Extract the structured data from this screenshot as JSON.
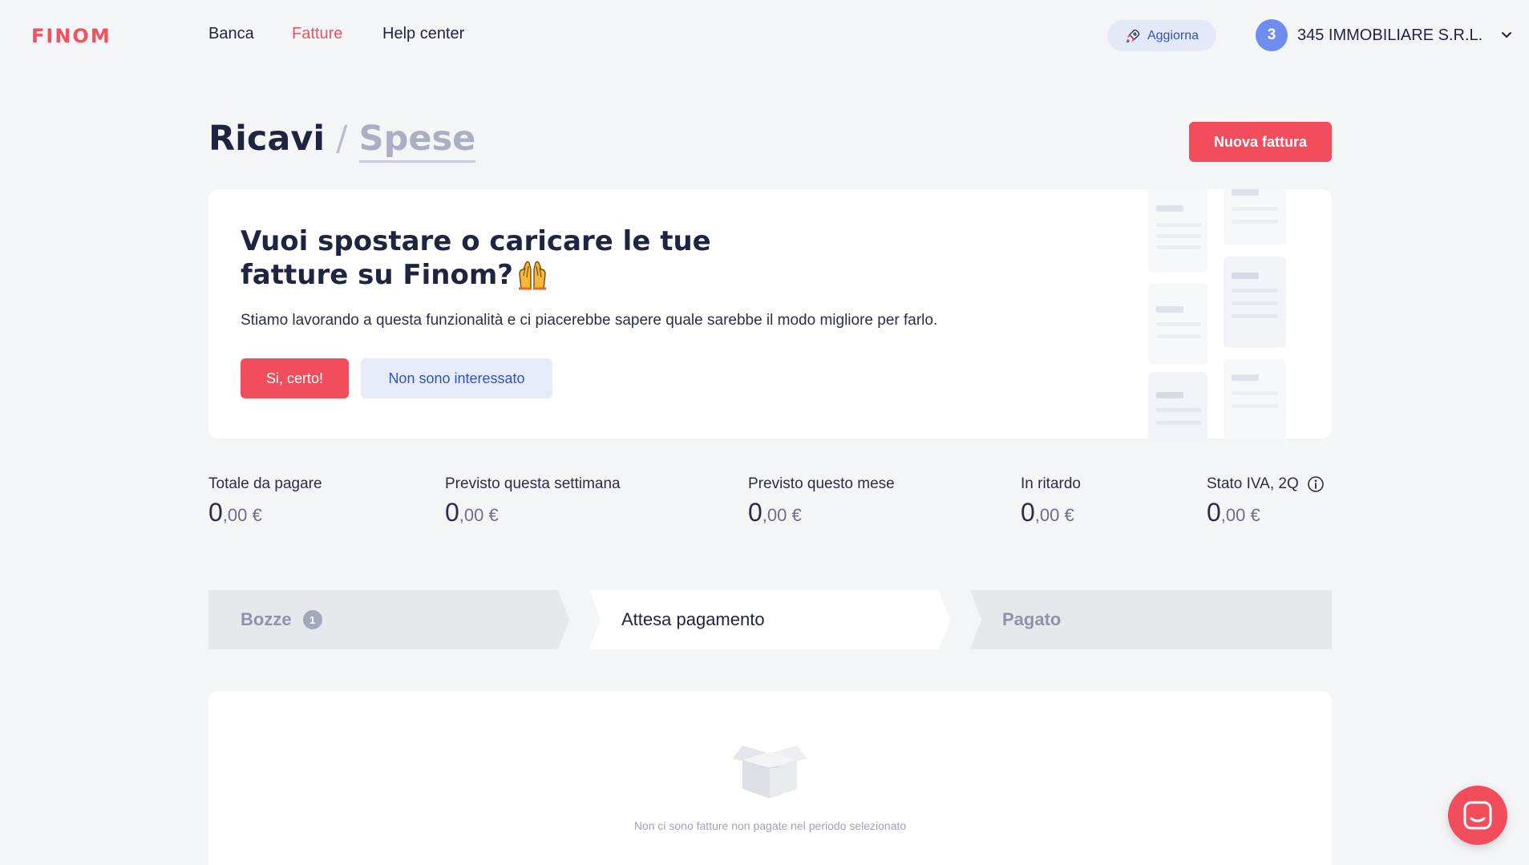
{
  "brand": {
    "logo": "FINOM",
    "accent": "#f24d5c"
  },
  "nav": {
    "items": [
      "Banca",
      "Fatture",
      "Help center"
    ],
    "active": "Fatture"
  },
  "upgrade": {
    "label": "Aggiorna",
    "icon": "rocket-icon"
  },
  "account": {
    "avatar": "3",
    "company": "345 IMMOBILIARE S.R.L."
  },
  "header": {
    "title_main": "Ricavi",
    "separator": "/",
    "title_secondary": "Spese",
    "new_invoice": "Nuova fattura"
  },
  "promo": {
    "title_line1": "Vuoi spostare o caricare le tue",
    "title_line2": "fatture su Finom?",
    "emoji": "raising-hands-emoji",
    "text": "Stiamo lavorando a questa funzionalità e ci piacerebbe sapere quale sarebbe il modo migliore per farlo.",
    "yes": "Si, certo!",
    "no": "Non sono interessato"
  },
  "stats": [
    {
      "label": "Totale da pagare",
      "int": "0",
      "cents": ",00 €"
    },
    {
      "label": "Previsto questa settimana",
      "int": "0",
      "cents": ",00 €"
    },
    {
      "label": "Previsto questo mese",
      "int": "0",
      "cents": ",00 €"
    },
    {
      "label": "In ritardo",
      "int": "0",
      "cents": ",00 €"
    },
    {
      "label": "Stato IVA, 2Q",
      "int": "0",
      "cents": ",00 €"
    }
  ],
  "tabs": [
    {
      "label": "Bozze",
      "badge": "1"
    },
    {
      "label": "Attesa pagamento"
    },
    {
      "label": "Pagato"
    }
  ],
  "empty": {
    "text": "Non ci sono fatture non pagate nel periodo selezionato",
    "icon": "empty-box-icon"
  },
  "chat": {
    "icon": "chat-icon"
  }
}
